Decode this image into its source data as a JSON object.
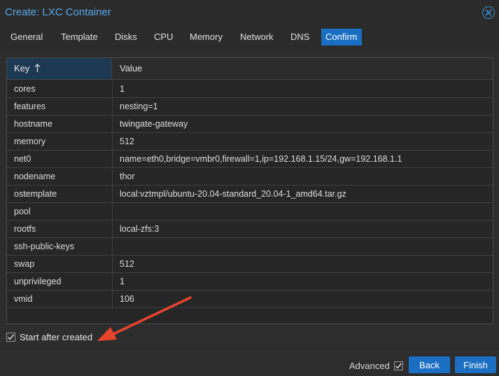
{
  "window": {
    "title": "Create: LXC Container"
  },
  "tabs": [
    {
      "label": "General",
      "active": false
    },
    {
      "label": "Template",
      "active": false
    },
    {
      "label": "Disks",
      "active": false
    },
    {
      "label": "CPU",
      "active": false
    },
    {
      "label": "Memory",
      "active": false
    },
    {
      "label": "Network",
      "active": false
    },
    {
      "label": "DNS",
      "active": false
    },
    {
      "label": "Confirm",
      "active": true
    }
  ],
  "grid": {
    "columns": {
      "key": "Key",
      "value": "Value"
    },
    "sort_icon": "sort-ascending-arrow-icon",
    "rows": [
      {
        "key": "cores",
        "value": "1"
      },
      {
        "key": "features",
        "value": "nesting=1"
      },
      {
        "key": "hostname",
        "value": "twingate-gateway"
      },
      {
        "key": "memory",
        "value": "512"
      },
      {
        "key": "net0",
        "value": "name=eth0,bridge=vmbr0,firewall=1,ip=192.168.1.15/24,gw=192.168.1.1"
      },
      {
        "key": "nodename",
        "value": "thor"
      },
      {
        "key": "ostemplate",
        "value": "local:vztmpl/ubuntu-20.04-standard_20.04-1_amd64.tar.gz"
      },
      {
        "key": "pool",
        "value": ""
      },
      {
        "key": "rootfs",
        "value": "local-zfs:3"
      },
      {
        "key": "ssh-public-keys",
        "value": ""
      },
      {
        "key": "swap",
        "value": "512"
      },
      {
        "key": "unprivileged",
        "value": "1"
      },
      {
        "key": "vmid",
        "value": "106"
      }
    ]
  },
  "start_after_created": {
    "label": "Start after created",
    "checked": true
  },
  "footer": {
    "advanced_label": "Advanced",
    "advanced_checked": true,
    "back_label": "Back",
    "finish_label": "Finish"
  },
  "colors": {
    "accent": "#1b6fc2",
    "title": "#57a8e8",
    "annotation_arrow": "#e8432d"
  }
}
